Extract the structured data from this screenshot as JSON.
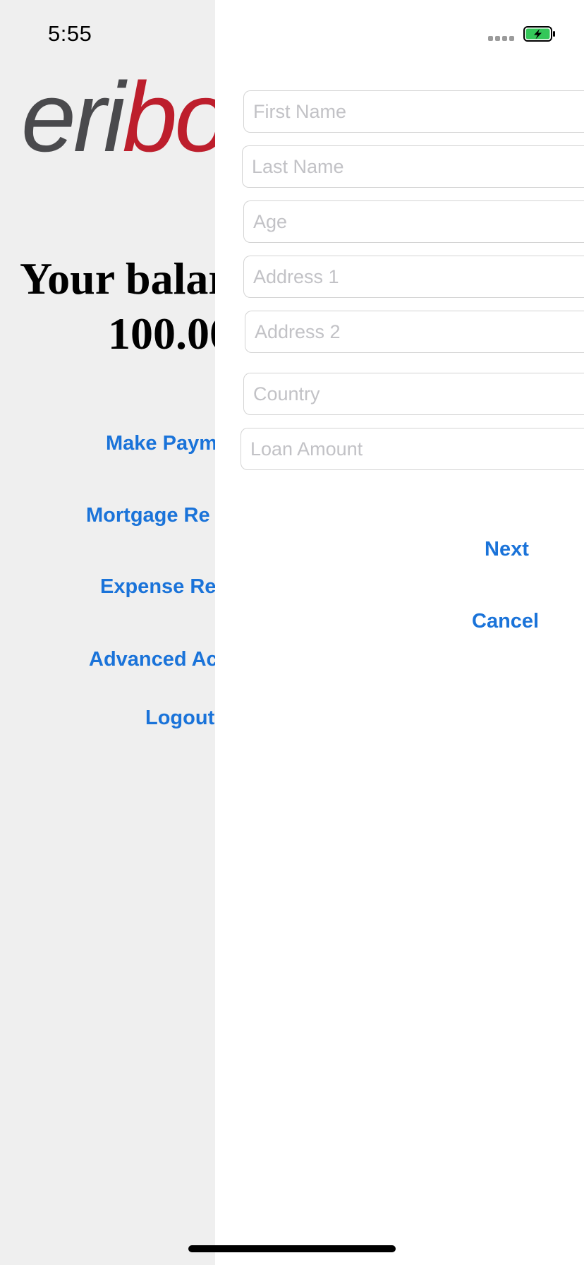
{
  "status_bar": {
    "time": "5:55",
    "battery_color": "#34c759",
    "icons": [
      "signal-dots-icon",
      "battery-charging-icon"
    ]
  },
  "background_screen": {
    "logo": {
      "part_a": "eri",
      "part_b": "bo"
    },
    "balance": {
      "line1": "Your balar",
      "line2": "100.00"
    },
    "menu": [
      "Make Paym",
      "Mortgage Re",
      "Expense Re",
      "Advanced Ac",
      "Logout"
    ],
    "link_color": "#1a73d9"
  },
  "form": {
    "fields": [
      {
        "placeholder": "First Name",
        "value": ""
      },
      {
        "placeholder": "Last Name",
        "value": ""
      },
      {
        "placeholder": "Age",
        "value": ""
      },
      {
        "placeholder": "Address 1",
        "value": ""
      },
      {
        "placeholder": "Address 2",
        "value": ""
      },
      {
        "placeholder": "Country",
        "value": ""
      },
      {
        "placeholder": "Loan Amount",
        "value": ""
      }
    ],
    "next_label": "Next",
    "cancel_label": "Cancel"
  }
}
